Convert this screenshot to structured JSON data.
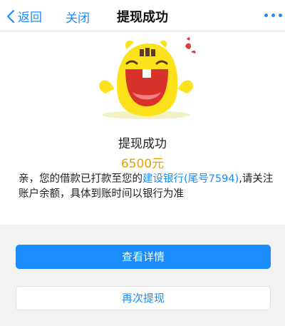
{
  "navbar": {
    "back_label": "返回",
    "close_label": "关闭",
    "title": "提现成功"
  },
  "result": {
    "status": "提现成功",
    "amount": "6500元",
    "message_prefix": "亲，您的借款已打款至您的",
    "bank": "建设银行(尾号7594)",
    "message_suffix": ",请关注账户余额，具体到账时间以银行为准"
  },
  "actions": {
    "view_details": "查看详情",
    "withdraw_again": "再次提现"
  },
  "colors": {
    "accent": "#1a8cff",
    "amount": "#e8a000",
    "mascot": "#fce11b"
  }
}
